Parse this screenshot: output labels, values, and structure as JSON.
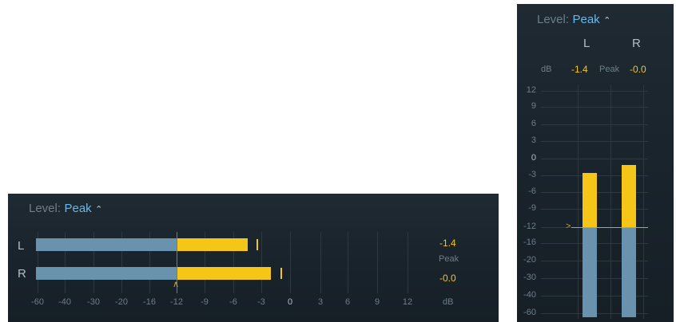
{
  "colors": {
    "panel_bg": "#1a242c",
    "label_gray": "#6d7e8a",
    "accent_blue": "#6ab8e8",
    "meter_blue": "#6892ad",
    "meter_yellow": "#f5c518"
  },
  "horizontal_meter": {
    "level_label": "Level:",
    "level_value": "Peak",
    "level_arrows_icon": "up-down-chevron-icon",
    "channels": [
      {
        "label": "L",
        "peak_db": -4.5,
        "hold_db": -3.5
      },
      {
        "label": "R",
        "peak_db": -2.0,
        "hold_db": -1.0
      }
    ],
    "threshold_db": -12,
    "readout_left": "-1.4",
    "readout_mode": "Peak",
    "readout_right": "-0.0",
    "scale": [
      "-60",
      "-40",
      "-30",
      "-20",
      "-16",
      "-12",
      "-9",
      "-6",
      "-3",
      "0",
      "3",
      "6",
      "9",
      "12"
    ],
    "scale_unit": "dB"
  },
  "vertical_meter": {
    "level_label": "Level:",
    "level_value": "Peak",
    "level_arrows_icon": "up-down-chevron-icon",
    "channel_left": "L",
    "channel_right": "R",
    "unit": "dB",
    "readout_left": "-1.4",
    "readout_mode": "Peak",
    "readout_right": "-0.0",
    "scale": [
      "12",
      "9",
      "6",
      "3",
      "0",
      "-3",
      "-6",
      "-9",
      "-12",
      "-16",
      "-20",
      "-30",
      "-40",
      "-60"
    ],
    "channels": [
      {
        "label": "L",
        "peak_db": -2.5
      },
      {
        "label": "R",
        "peak_db": -1.2
      }
    ],
    "threshold_db": -12
  }
}
